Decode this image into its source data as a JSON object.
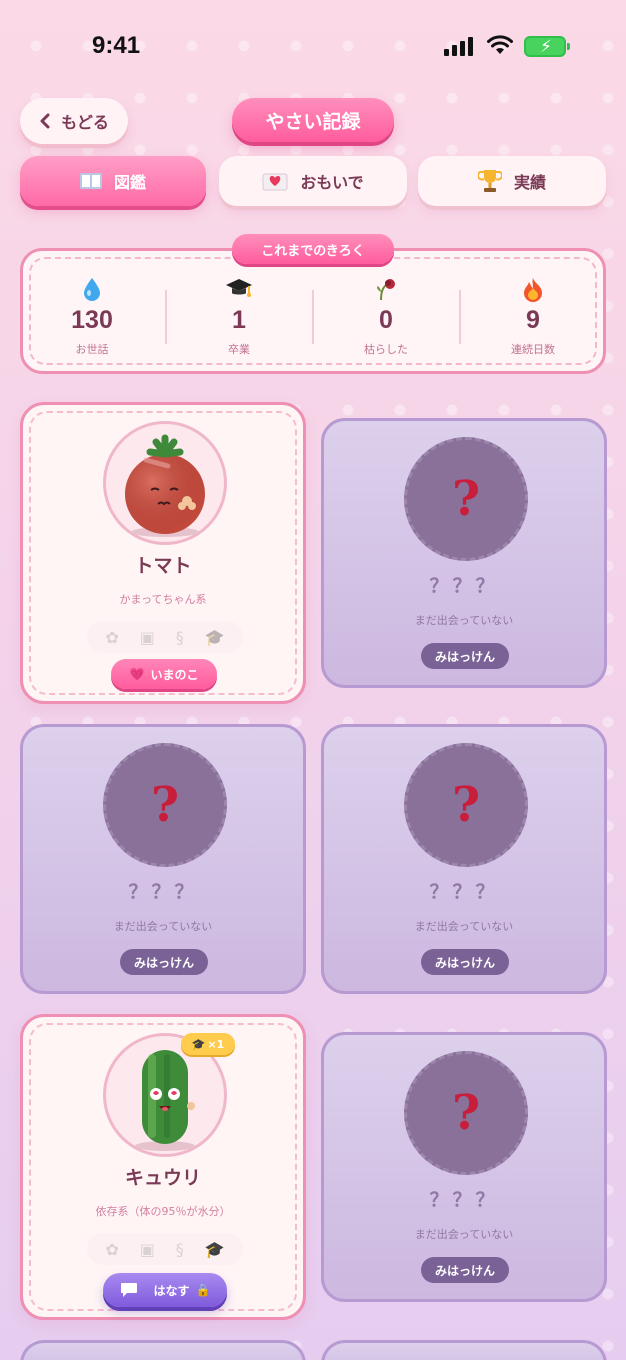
{
  "status_bar": {
    "time": "9:41"
  },
  "header": {
    "back_label": "もどる",
    "title": "やさい記録"
  },
  "tabs": [
    {
      "label": "図鑑",
      "icon": "book-icon",
      "active": true
    },
    {
      "label": "おもいで",
      "icon": "heart-letter-icon",
      "active": false
    },
    {
      "label": "実績",
      "icon": "trophy-icon",
      "active": false
    }
  ],
  "stats": {
    "label": "これまでのきろく",
    "items": [
      {
        "icon": "water-drop-icon",
        "value": "130",
        "label": "お世話"
      },
      {
        "icon": "graduation-cap-icon",
        "value": "1",
        "label": "卒業"
      },
      {
        "icon": "wilted-flower-icon",
        "value": "0",
        "label": "枯らした"
      },
      {
        "icon": "fire-icon",
        "value": "9",
        "label": "連続日数"
      }
    ]
  },
  "cards": [
    {
      "found": true,
      "name": "トマト",
      "type": "かまってちゃん系",
      "button": "いまのこ",
      "graduations": ""
    },
    {
      "found": false,
      "name": "？？？",
      "type": "まだ出会っていない",
      "button": "みはっけん"
    },
    {
      "found": false,
      "name": "？？？",
      "type": "まだ出会っていない",
      "button": "みはっけん"
    },
    {
      "found": false,
      "name": "？？？",
      "type": "まだ出会っていない",
      "button": "みはっけん"
    },
    {
      "found": true,
      "name": "キュウリ",
      "type": "依存系（体の95％が水分）",
      "button": "はなす",
      "graduations": "×1"
    },
    {
      "found": false,
      "name": "？？？",
      "type": "まだ出会っていない",
      "button": "みはっけん"
    }
  ],
  "mystery_mark": "?",
  "colors": {
    "accent": "#ff5c9c",
    "locked": "#7b6296",
    "talk": "#7f5bdc"
  }
}
